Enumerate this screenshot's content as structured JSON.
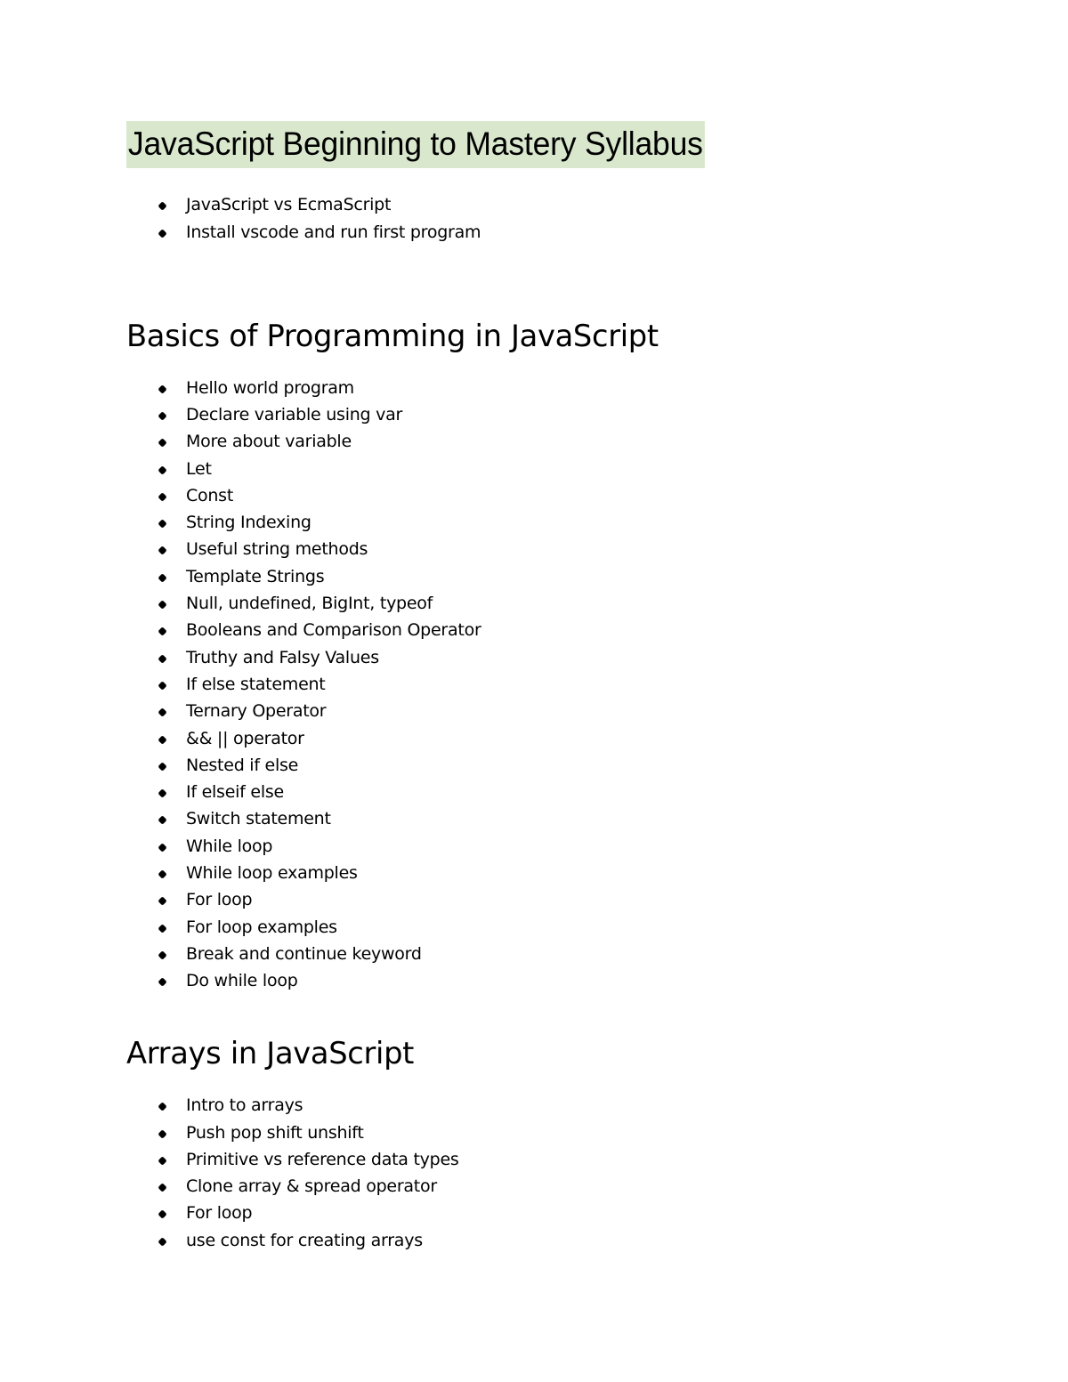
{
  "document": {
    "title": "JavaScript Beginning to Mastery Syllabus",
    "title_highlight_color": "#d9e8cd",
    "text_color": "#000000",
    "background_color": "#ffffff",
    "bullet_glyph": "filled-diamond"
  },
  "intro": {
    "items": [
      {
        "label": "JavaScript vs EcmaScript"
      },
      {
        "label": "Install vscode and run first program"
      }
    ]
  },
  "sections": [
    {
      "heading": "Basics of Programming in JavaScript",
      "items": [
        {
          "label": "Hello world program"
        },
        {
          "label": "Declare variable using var"
        },
        {
          "label": "More about variable"
        },
        {
          "label": "Let"
        },
        {
          "label": "Const"
        },
        {
          "label": "String Indexing"
        },
        {
          "label": "Useful string methods"
        },
        {
          "label": "Template Strings"
        },
        {
          "label": "Null, undefined, BigInt, typeof"
        },
        {
          "label": "Booleans and Comparison Operator"
        },
        {
          "label": "Truthy and Falsy Values"
        },
        {
          "label": "If else statement"
        },
        {
          "label": "Ternary Operator"
        },
        {
          "label": "&& || operator"
        },
        {
          "label": "Nested if else"
        },
        {
          "label": "If elseif else"
        },
        {
          "label": "Switch statement"
        },
        {
          "label": "While loop"
        },
        {
          "label": "While loop examples"
        },
        {
          "label": "For loop"
        },
        {
          "label": "For loop examples"
        },
        {
          "label": "Break and continue keyword"
        },
        {
          "label": "Do while loop"
        }
      ]
    },
    {
      "heading": "Arrays in JavaScript",
      "items": [
        {
          "label": "Intro to arrays"
        },
        {
          "label": "Push pop shift unshift"
        },
        {
          "label": "Primitive vs reference data types"
        },
        {
          "label": "Clone array & spread operator"
        },
        {
          "label": "For loop"
        },
        {
          "label": "use const for creating arrays"
        }
      ]
    }
  ]
}
